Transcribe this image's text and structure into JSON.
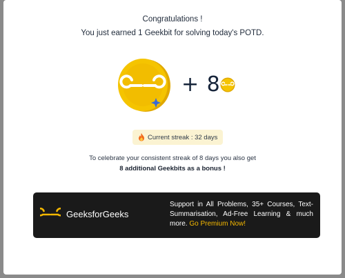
{
  "modal": {
    "title": "Congratulations !",
    "subtitle": "You just earned 1 Geekbit for solving today's POTD.",
    "reward_text": "+ 8",
    "streak_label": "Current streak : 32 days",
    "celebrate_text": "To celebrate your consistent streak of 8 days you also get",
    "bonus_text": "8 additional Geekbits as a bonus !"
  },
  "banner": {
    "brand": "GeeksforGeeks",
    "text": "Support in All Problems, 35+ Courses, Text-Summarisation, Ad-Free Learning & much more.",
    "cta": "Go Premium Now!"
  },
  "colors": {
    "coin_gold": "#f2c200",
    "coin_dark": "#d9a400",
    "brand_green": "#2f8d46",
    "cta_yellow": "#f5b800",
    "streak_bg": "#fbf3d2"
  },
  "icons": [
    "gfg-coin-icon",
    "sparkle-icon",
    "fire-icon",
    "gfg-logo-icon"
  ]
}
